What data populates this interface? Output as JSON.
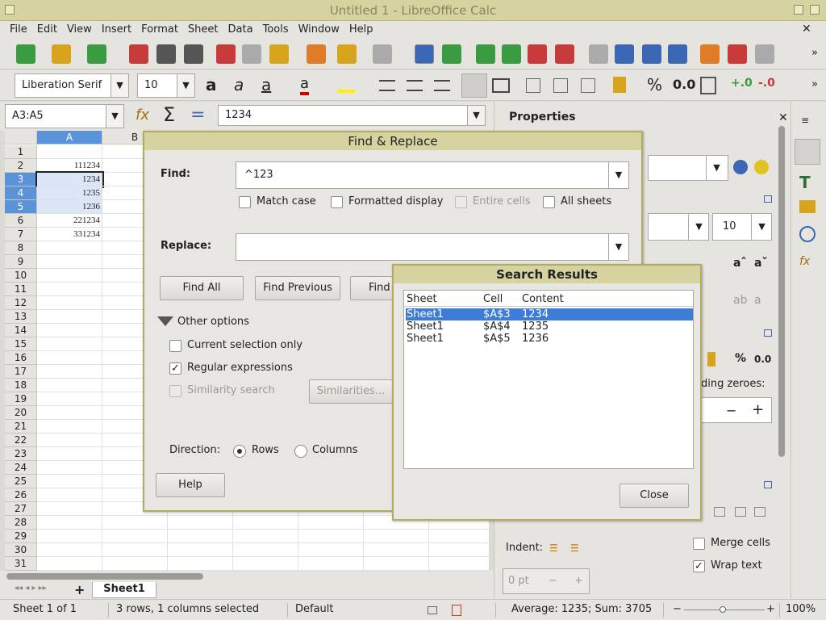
{
  "window": {
    "title": "Untitled 1 - LibreOffice Calc"
  },
  "menu": [
    "File",
    "Edit",
    "View",
    "Insert",
    "Format",
    "Sheet",
    "Data",
    "Tools",
    "Window",
    "Help"
  ],
  "format": {
    "font": "Liberation Serif",
    "size": "10",
    "percent": "%",
    "decimal": "0.0"
  },
  "formula": {
    "namebox": "A3:A5",
    "sigma": "Σ",
    "equals": "=",
    "content": "1234"
  },
  "grid": {
    "columns": [
      "A",
      "B"
    ],
    "rows": [
      "1",
      "2",
      "3",
      "4",
      "5",
      "6",
      "7",
      "8",
      "9",
      "10",
      "11",
      "12",
      "13",
      "14",
      "15",
      "16",
      "17",
      "18",
      "19",
      "20",
      "21",
      "22",
      "23",
      "24",
      "25",
      "26",
      "27",
      "28",
      "29",
      "30",
      "31"
    ],
    "values": {
      "2": "111234",
      "3": "1234",
      "4": "1235",
      "5": "1236",
      "6": "221234",
      "7": "331234"
    }
  },
  "sheet_tab": "Sheet1",
  "sidebar": {
    "title": "Properties",
    "size": "10",
    "percent": "%",
    "decimal": "0.0",
    "leading": "ding zeroes:",
    "indent_label": "Indent:",
    "indent_value": "0 pt",
    "merge": "Merge cells",
    "wrap": "Wrap text"
  },
  "find_replace": {
    "title": "Find & Replace",
    "find_label": "Find:",
    "find_value": "^123",
    "match_case": "Match case",
    "formatted": "Formatted display",
    "entire": "Entire cells",
    "all_sheets": "All sheets",
    "replace_label": "Replace:",
    "replace_value": "",
    "find_all": "Find All",
    "find_prev": "Find Previous",
    "find_next": "Find",
    "other": "Other options",
    "current_sel": "Current selection only",
    "regex": "Regular expressions",
    "similarity": "Similarity search",
    "similarities": "Similarities...",
    "direction": "Direction:",
    "rows": "Rows",
    "columns": "Columns",
    "help": "Help"
  },
  "search_results": {
    "title": "Search Results",
    "headers": [
      "Sheet",
      "Cell",
      "Content"
    ],
    "rows": [
      [
        "Sheet1",
        "$A$3",
        "1234"
      ],
      [
        "Sheet1",
        "$A$4",
        "1235"
      ],
      [
        "Sheet1",
        "$A$5",
        "1236"
      ]
    ],
    "close": "Close"
  },
  "status": {
    "sheet": "Sheet 1 of 1",
    "selection": "3 rows, 1 columns selected",
    "style": "Default",
    "stats": "Average: 1235; Sum: 3705",
    "zoom": "100%"
  }
}
